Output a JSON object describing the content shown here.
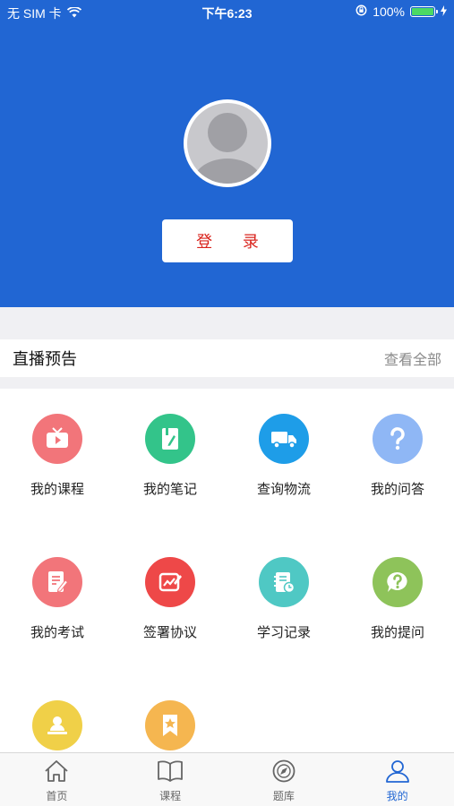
{
  "status_bar": {
    "carrier": "无 SIM 卡",
    "time": "下午6:23",
    "battery": "100%",
    "battery_level": 1.0
  },
  "header": {
    "login_label": "登 录"
  },
  "live": {
    "title": "直播预告",
    "view_all": "查看全部"
  },
  "grid": [
    {
      "label": "我的课程",
      "icon": "tv-play-icon",
      "color": "#f2757a"
    },
    {
      "label": "我的笔记",
      "icon": "notebook-pen-icon",
      "color": "#33c48a"
    },
    {
      "label": "查询物流",
      "icon": "truck-icon",
      "color": "#1e9de8"
    },
    {
      "label": "我的问答",
      "icon": "question-icon",
      "color": "#8fb7f5"
    },
    {
      "label": "我的考试",
      "icon": "exam-paper-icon",
      "color": "#f2757a"
    },
    {
      "label": "签署协议",
      "icon": "sign-contract-icon",
      "color": "#ee4848"
    },
    {
      "label": "学习记录",
      "icon": "study-record-icon",
      "color": "#4fc8c4"
    },
    {
      "label": "我的提问",
      "icon": "question-bubble-icon",
      "color": "#8ec35a"
    },
    {
      "label": "",
      "icon": "teacher-icon",
      "color": "#f0d048"
    },
    {
      "label": "",
      "icon": "bookmark-star-icon",
      "color": "#f5b650"
    }
  ],
  "tabs": [
    {
      "label": "首页",
      "icon": "home-icon"
    },
    {
      "label": "课程",
      "icon": "book-icon"
    },
    {
      "label": "题库",
      "icon": "compass-icon"
    },
    {
      "label": "我的",
      "icon": "user-icon",
      "active": true
    }
  ],
  "colors": {
    "header_bg": "#2166d3",
    "login_text": "#d9231c",
    "active_tab": "#2166d3"
  }
}
